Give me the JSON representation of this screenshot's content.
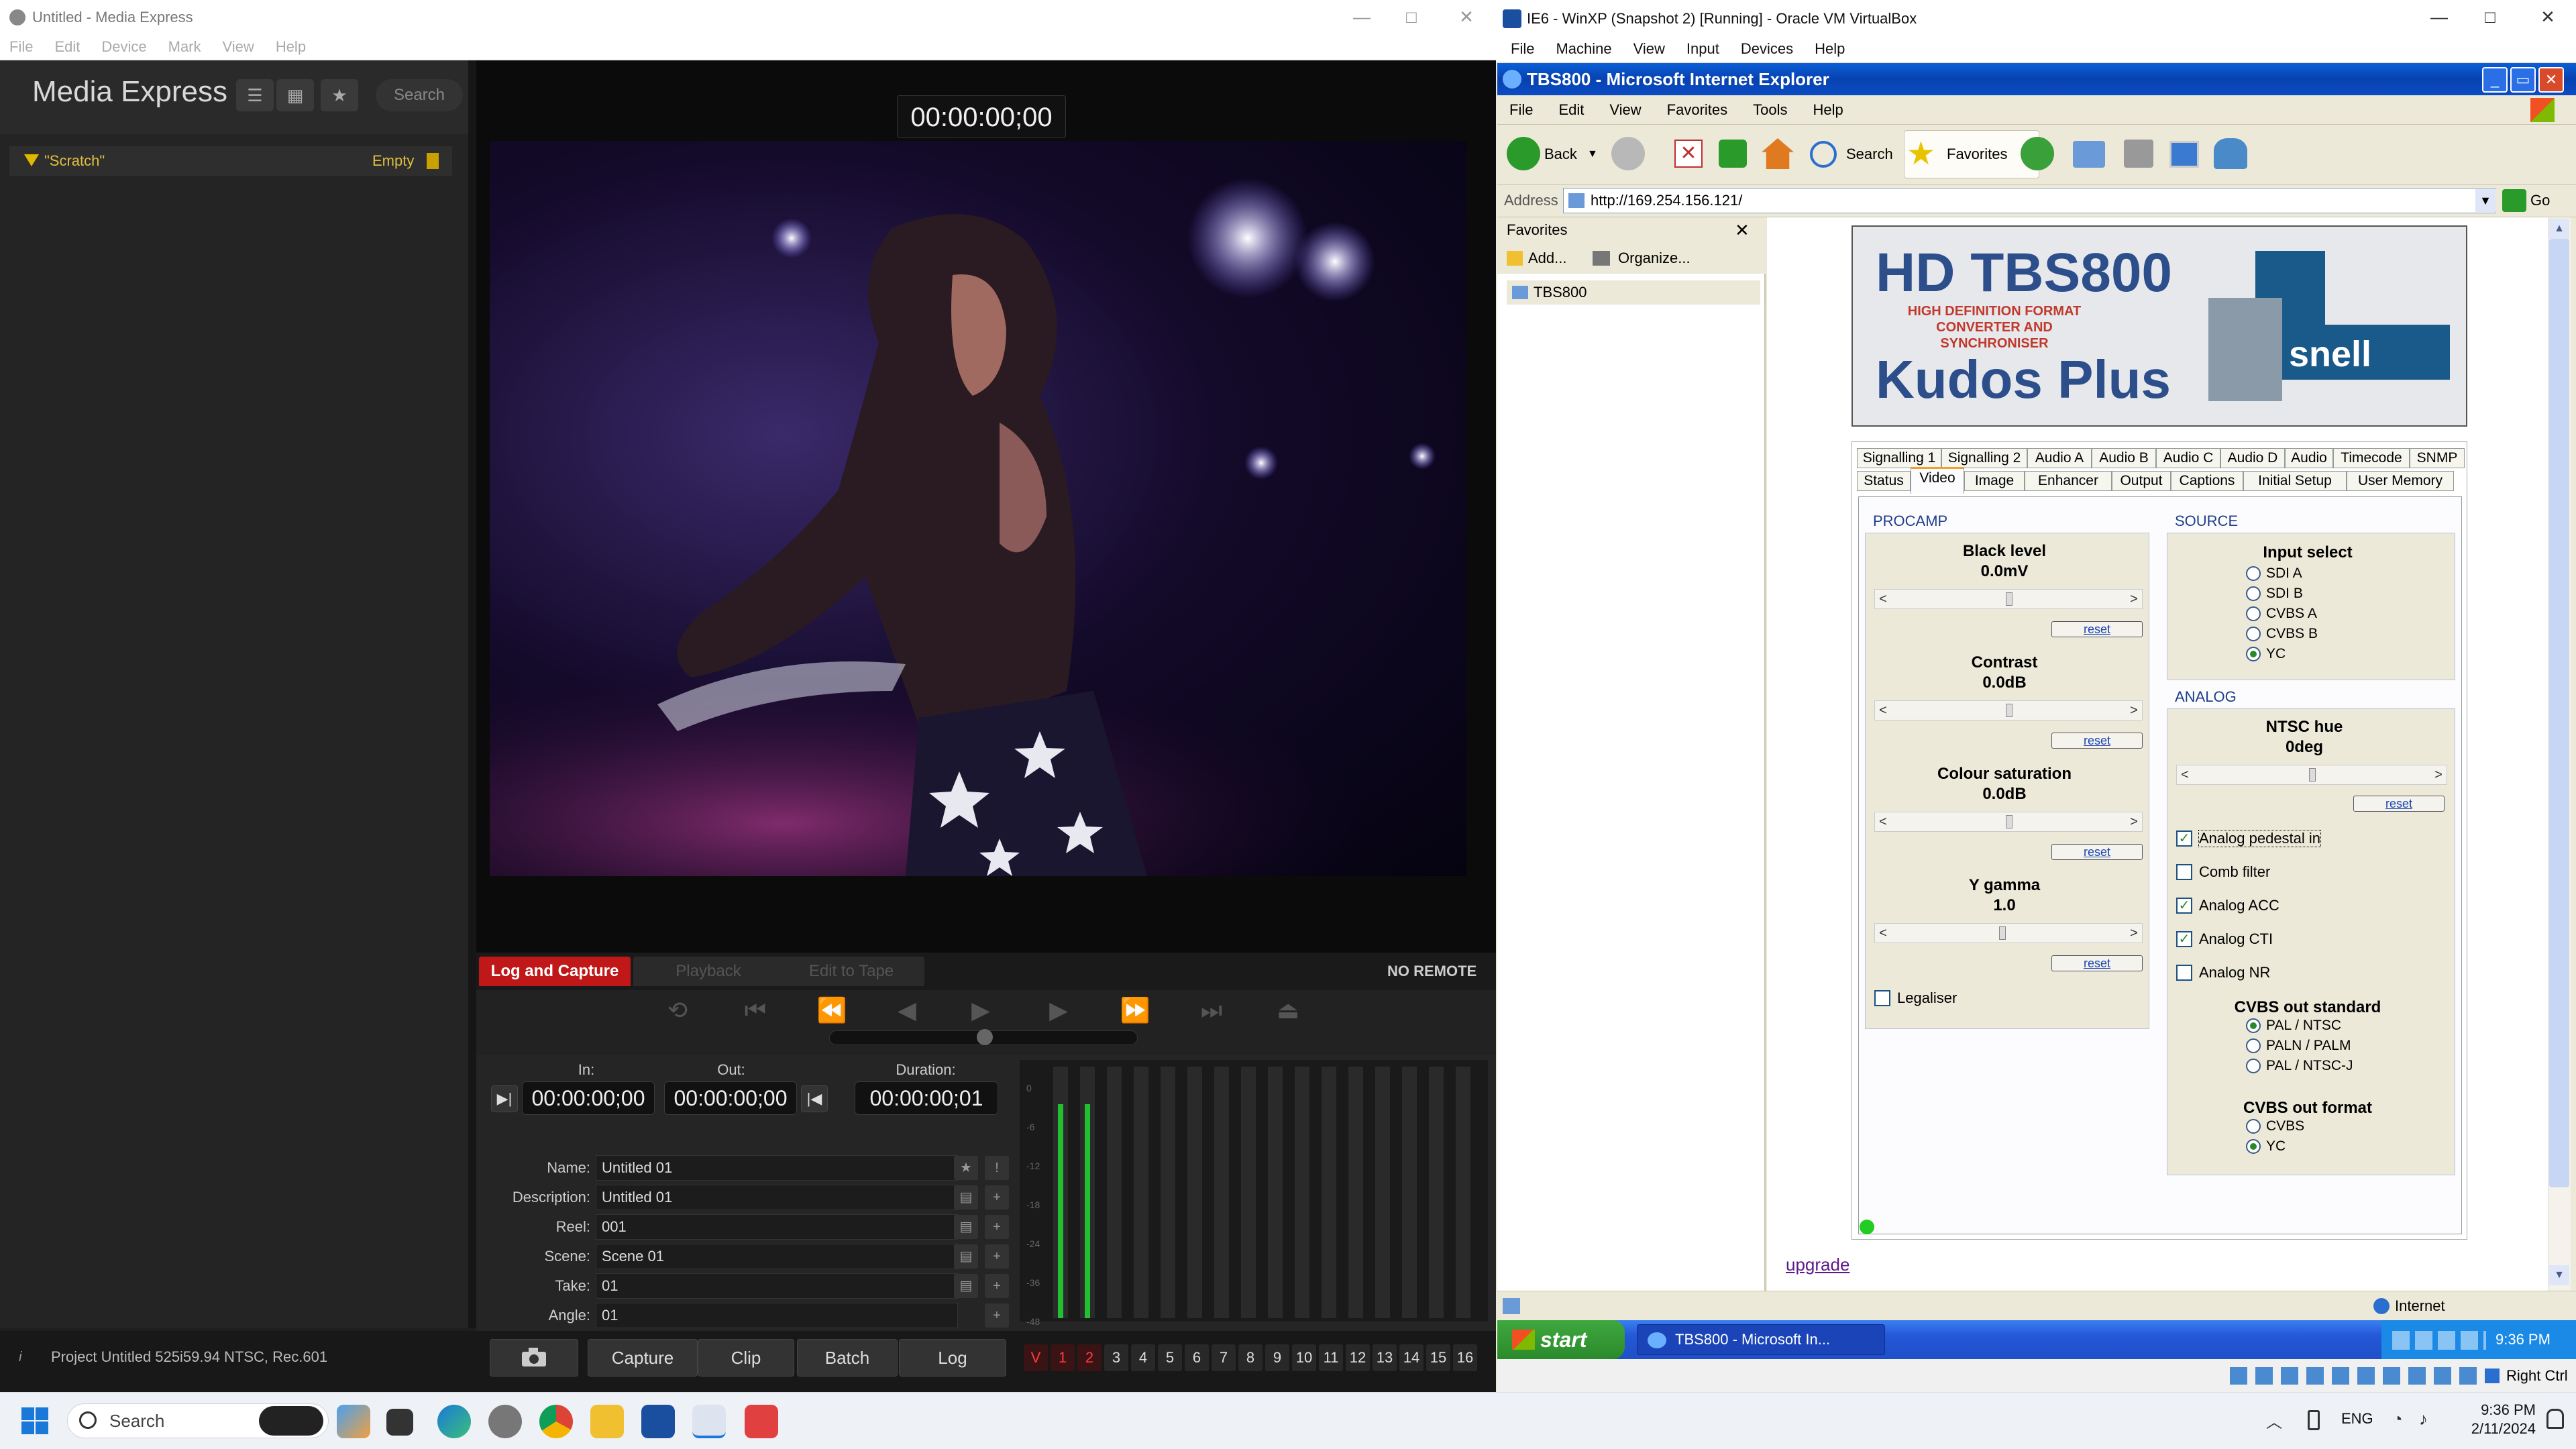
{
  "media_express": {
    "title": "Untitled - Media Express",
    "menu": [
      "File",
      "Edit",
      "Device",
      "Mark",
      "View",
      "Help"
    ],
    "logo": "Media Express",
    "search": "Search",
    "bin": {
      "name": "\"Scratch\"",
      "status": "Empty"
    },
    "timecode_top": "00:00:00;00",
    "tabs": {
      "log": "Log and Capture",
      "playback": "Playback",
      "edit": "Edit to Tape"
    },
    "remote_status": "NO REMOTE",
    "in_label": "In:",
    "out_label": "Out:",
    "duration_label": "Duration:",
    "in_tc": "00:00:00;00",
    "out_tc": "00:00:00;00",
    "duration_tc": "00:00:00;01",
    "fields": [
      {
        "label": "Name:",
        "value": "Untitled 01"
      },
      {
        "label": "Description:",
        "value": "Untitled 01"
      },
      {
        "label": "Reel:",
        "value": "001"
      },
      {
        "label": "Scene:",
        "value": "Scene 01"
      },
      {
        "label": "Take:",
        "value": "01"
      },
      {
        "label": "Angle:",
        "value": "01"
      }
    ],
    "meter_scale": [
      "0",
      "-6",
      "-12",
      "-18",
      "-24",
      "-36",
      "-48"
    ],
    "meter_levels": [
      0.85,
      0.85
    ],
    "project_status": "Project Untitled   525i59.94 NTSC, Rec.601",
    "bottom_buttons": [
      "Capture",
      "Clip",
      "Batch",
      "Log"
    ],
    "channels": [
      "V",
      "1",
      "2",
      "3",
      "4",
      "5",
      "6",
      "7",
      "8",
      "9",
      "10",
      "11",
      "12",
      "13",
      "14",
      "15",
      "16"
    ]
  },
  "virtualbox": {
    "title": "IE6 - WinXP (Snapshot 2) [Running] - Oracle VM VirtualBox",
    "menu": [
      "File",
      "Machine",
      "View",
      "Input",
      "Devices",
      "Help"
    ],
    "status_right": "Right Ctrl"
  },
  "ie": {
    "title": "TBS800 - Microsoft Internet Explorer",
    "menu": [
      "File",
      "Edit",
      "View",
      "Favorites",
      "Tools",
      "Help"
    ],
    "toolbar": {
      "back": "Back",
      "search": "Search",
      "favorites": "Favorites"
    },
    "address_label": "Address",
    "address": "http://169.254.156.121/",
    "go": "Go",
    "favorites_pane": {
      "title": "Favorites",
      "add": "Add...",
      "organize": "Organize...",
      "item": "TBS800"
    },
    "status_zone": "Internet"
  },
  "device": {
    "title": "HD TBS800",
    "subtitle": "HIGH DEFINITION FORMAT CONVERTER AND SYNCHRONISER",
    "product": "Kudos Plus",
    "brand": "snell",
    "tabs_row1": [
      "Signalling 1",
      "Signalling 2",
      "Audio A",
      "Audio B",
      "Audio C",
      "Audio D",
      "Audio",
      "Timecode",
      "SNMP"
    ],
    "tabs_row2": [
      "Status",
      "Video",
      "Image",
      "Enhancer",
      "Output",
      "Captions",
      "Initial Setup",
      "User Memory"
    ],
    "active_tab": "Video",
    "procamp": {
      "label": "PROCAMP",
      "controls": [
        {
          "name": "Black level",
          "value": "0.0mV",
          "pos": 0.5
        },
        {
          "name": "Contrast",
          "value": "0.0dB",
          "pos": 0.5
        },
        {
          "name": "Colour saturation",
          "value": "0.0dB",
          "pos": 0.5
        },
        {
          "name": "Y gamma",
          "value": "1.0",
          "pos": 0.47
        }
      ],
      "reset": "reset",
      "legaliser": "Legaliser",
      "legaliser_checked": false
    },
    "source": {
      "label": "SOURCE",
      "title": "Input select",
      "options": [
        "SDI A",
        "SDI B",
        "CVBS A",
        "CVBS B",
        "YC"
      ],
      "selected": "YC"
    },
    "analog": {
      "label": "ANALOG",
      "hue_title": "NTSC hue",
      "hue_value": "0deg",
      "hue_pos": 0.5,
      "reset": "reset",
      "checks": [
        {
          "label": "Analog pedestal in",
          "checked": true
        },
        {
          "label": "Comb filter",
          "checked": false
        },
        {
          "label": "Analog ACC",
          "checked": true
        },
        {
          "label": "Analog CTI",
          "checked": true
        },
        {
          "label": "Analog NR",
          "checked": false
        }
      ],
      "cvbs_std_title": "CVBS out standard",
      "cvbs_std": [
        "PAL / NTSC",
        "PALN / PALM",
        "PAL / NTSC-J"
      ],
      "cvbs_std_selected": "PAL / NTSC",
      "cvbs_fmt_title": "CVBS out format",
      "cvbs_fmt": [
        "CVBS",
        "YC"
      ],
      "cvbs_fmt_selected": "YC"
    },
    "upgrade": "upgrade"
  },
  "xp_taskbar": {
    "start": "start",
    "task": "TBS800 - Microsoft In...",
    "time": "9:36 PM"
  },
  "win11": {
    "search": "Search",
    "lang": "ENG",
    "time": "9:36 PM",
    "date": "2/11/2024"
  }
}
